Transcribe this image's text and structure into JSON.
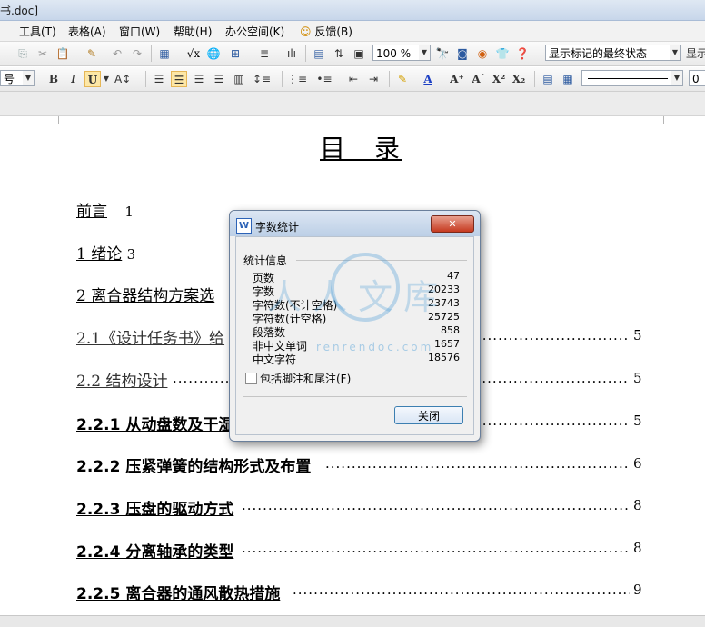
{
  "window": {
    "title": "书.doc]"
  },
  "menu": [
    "工具(T)",
    "表格(A)",
    "窗口(W)",
    "帮助(H)",
    "办公空间(K)",
    "反馈(B)"
  ],
  "toolbar1": {
    "zoom": "100 %",
    "track_state": "显示标记的最终状态",
    "show_label": "显示"
  },
  "toolbar2": {
    "font_size": "号",
    "bold": "B",
    "italic": "I",
    "underline": "U",
    "tail": "0"
  },
  "document": {
    "title": "目　录",
    "toc": [
      {
        "label": "前言",
        "page": "1"
      },
      {
        "label": "1 绪论",
        "page": "3"
      },
      {
        "label": "2  离合器结构方案选",
        "page": ""
      },
      {
        "label": "2.1《设计任务书》给",
        "page": "5"
      },
      {
        "label": "2.2 结构设计",
        "page": "5"
      },
      {
        "label": "2.2.1  从动盘数及干湿",
        "page": "5"
      },
      {
        "label": "2.2.2  压紧弹簧的结构形式及布置",
        "page": "6"
      },
      {
        "label": "2.2.3  压盘的驱动方式",
        "page": "8"
      },
      {
        "label": "2.2.4  分离轴承的类型",
        "page": "8"
      },
      {
        "label": "2.2.5  离合器的通风散热措施",
        "page": "9"
      }
    ]
  },
  "dialog": {
    "title": "字数统计",
    "close_x": "✕",
    "group_label": "统计信息",
    "stats": [
      {
        "label": "页数",
        "value": "47"
      },
      {
        "label": "字数",
        "value": "20233"
      },
      {
        "label": "字符数(不计空格)",
        "value": "23743"
      },
      {
        "label": "字符数(计空格)",
        "value": "25725"
      },
      {
        "label": "段落数",
        "value": "858"
      },
      {
        "label": "非中文单词",
        "value": "1657"
      },
      {
        "label": "中文字符",
        "value": "18576"
      }
    ],
    "checkbox_label": "包括脚注和尾注(F)",
    "close_button": "关闭"
  },
  "watermark": {
    "text": "人人文库",
    "url": "renrendoc.com"
  },
  "colors": {
    "dialog_border": "#6a7f9b",
    "close_red": "#c63a20",
    "button_border": "#3c7fb1"
  }
}
